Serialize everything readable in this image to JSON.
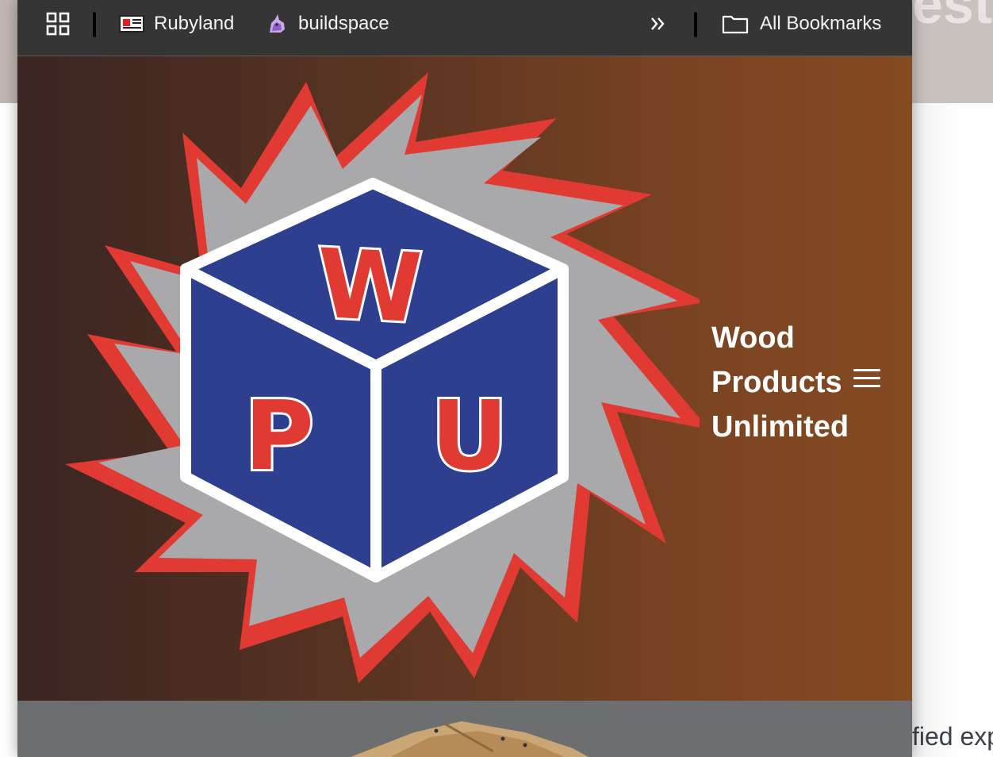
{
  "bookmarks_bar": {
    "items": [
      {
        "label": "Rubyland",
        "icon": "rubyland-favicon"
      },
      {
        "label": "buildspace",
        "icon": "unicorn-favicon"
      }
    ],
    "overflow_icon": "double-chevron-right-icon",
    "all_bookmarks": {
      "label": "All Bookmarks",
      "icon": "folder-icon"
    },
    "apps_icon": "apps-grid-icon"
  },
  "hero": {
    "brand_lines": [
      "Wood",
      "Products",
      "Unlimited"
    ],
    "logo": {
      "letters": [
        "W",
        "P",
        "U"
      ]
    },
    "menu_icon": "hamburger-menu-icon"
  },
  "background_page": {
    "heading_fragment": "est",
    "text_fragment": "fied exp"
  },
  "colors": {
    "toolbar_bg": "#353535",
    "hero_gradient_start": "#3a2522",
    "hero_gradient_end": "#854a22",
    "logo_red": "#e03a33",
    "logo_blue": "#2f3f8f",
    "logo_gray": "#a9a8aa"
  }
}
